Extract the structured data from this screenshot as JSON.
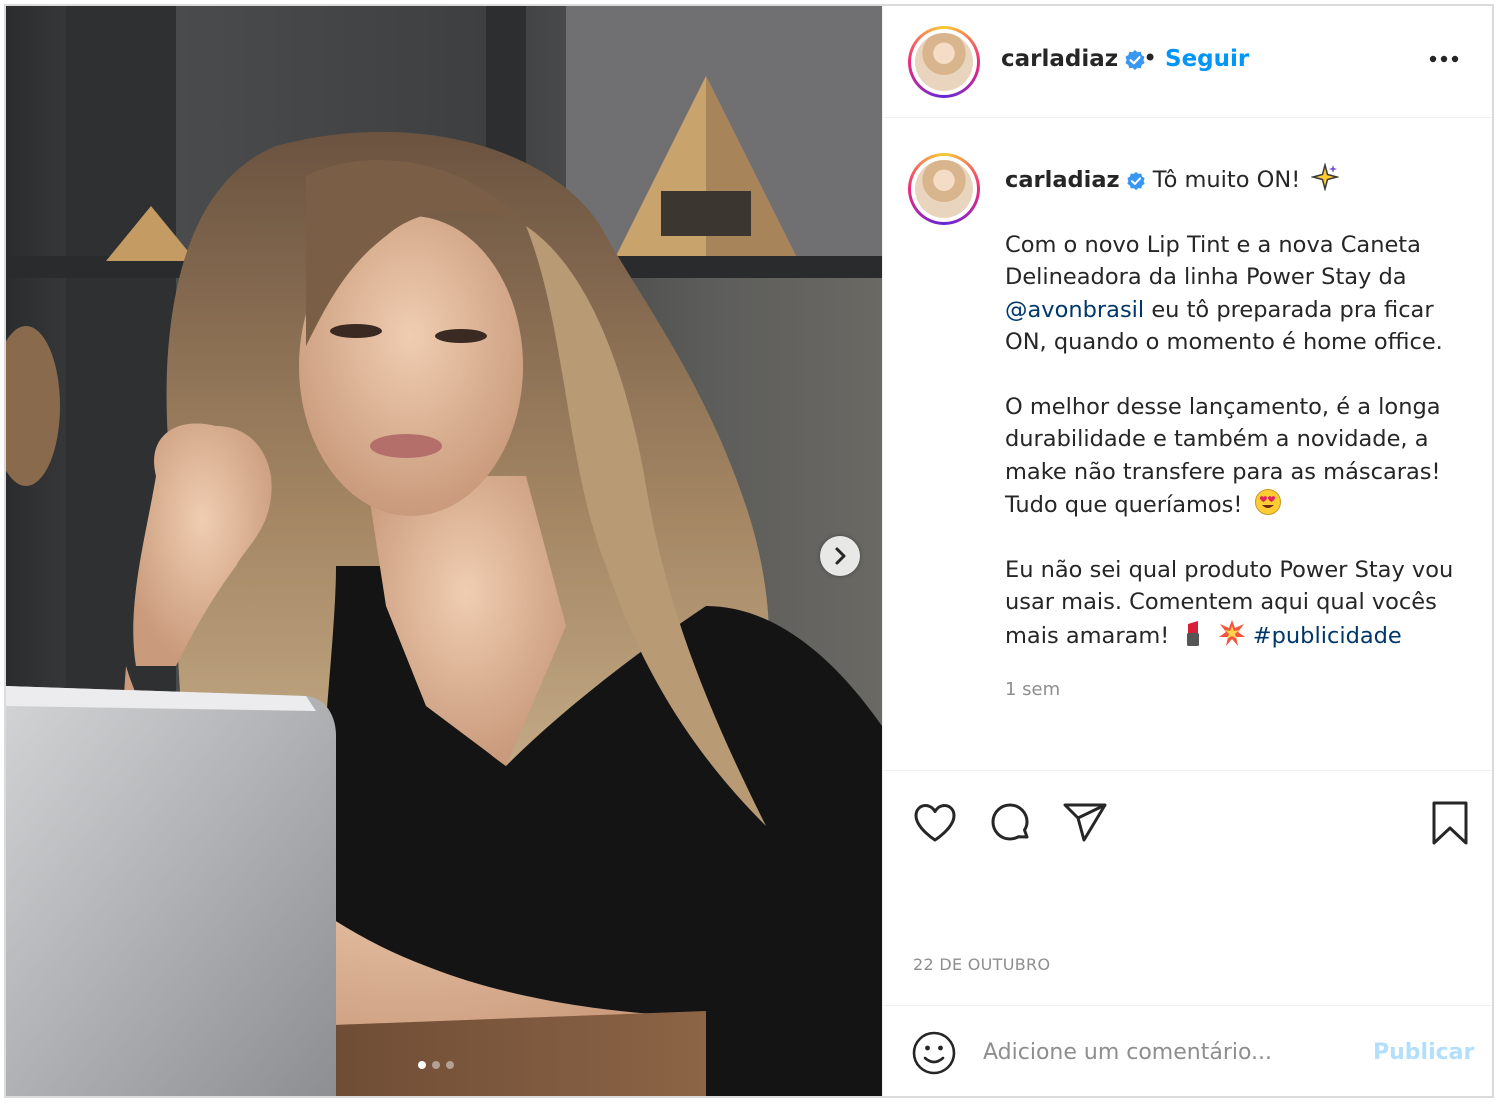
{
  "post": {
    "username": "carladiaz",
    "separator": "•",
    "follow_label": "Seguir",
    "more_icon": "more-options-icon"
  },
  "caption": {
    "username": "carladiaz",
    "headline": "Tô muito ON!",
    "p1_before": "Com o novo Lip Tint e a nova Caneta Delineadora da linha Power Stay da ",
    "p1_mention": "@avonbrasil",
    "p1_after": " eu tô preparada pra ficar ON, quando o momento é home office.",
    "p2": "O melhor desse lançamento, é a longa durabilidade e também a novidade, a make não transfere para as máscaras! Tudo que queríamos!",
    "p3": "Eu não sei qual produto Power Stay vou usar mais. Comentem aqui qual vocês mais amaram!",
    "hashtag": "#publicidade",
    "time_ago": "1 sem"
  },
  "actions": {
    "icons": [
      "heart-icon",
      "comment-icon",
      "share-icon",
      "bookmark-icon"
    ],
    "date": "22 DE OUTUBRO"
  },
  "comment": {
    "placeholder": "Adicione um comentário...",
    "publish_label": "Publicar"
  },
  "carousel": {
    "slide_count": 3,
    "current_slide": 1
  },
  "colors": {
    "link_blue": "#0095f6",
    "mention_blue": "#00376b",
    "publish_disabled": "#b2dffc",
    "muted": "#8e8e8e"
  }
}
